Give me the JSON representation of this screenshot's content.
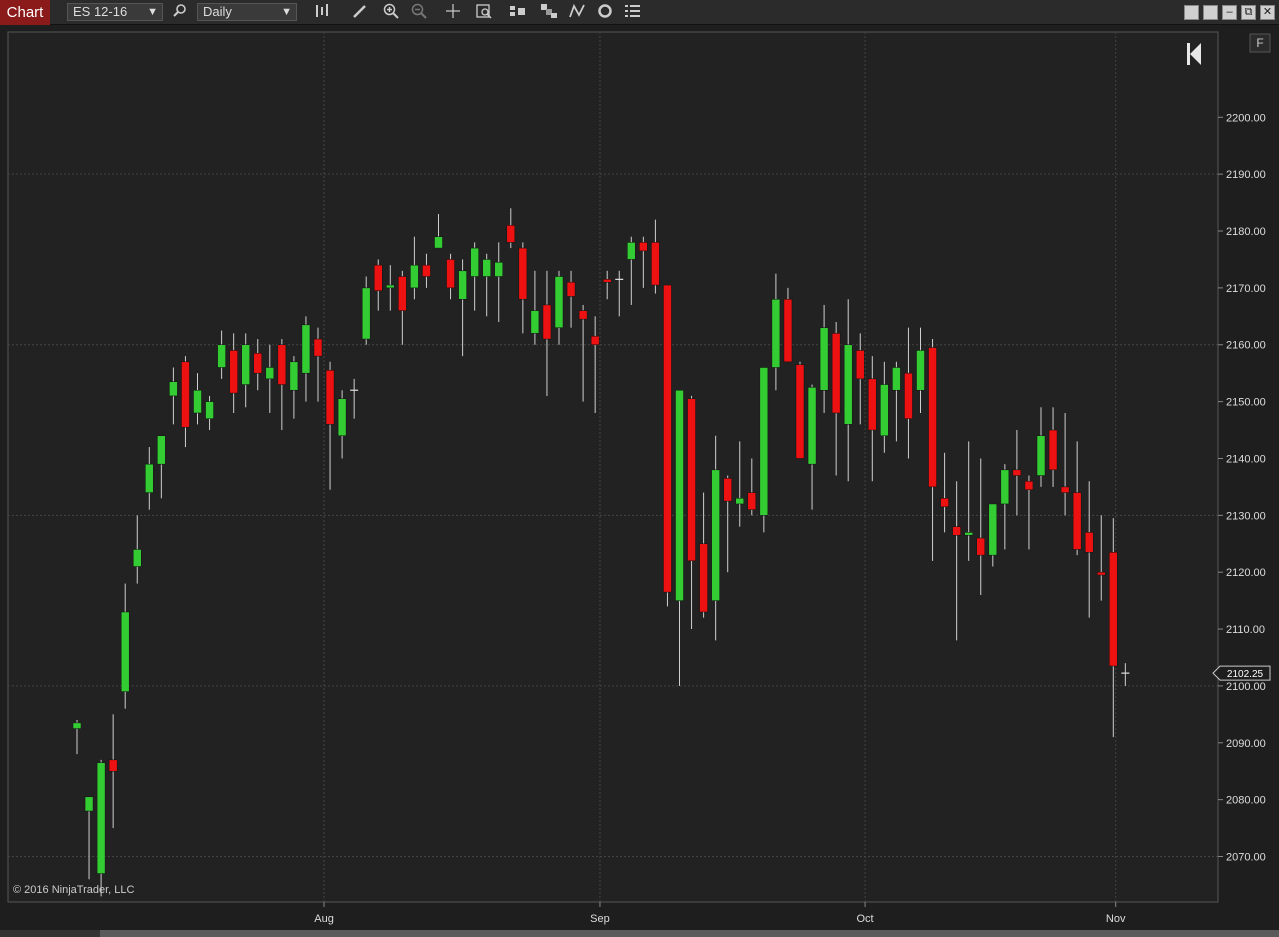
{
  "toolbar": {
    "tab_label": "Chart",
    "instrument": "ES 12-16",
    "interval": "Daily",
    "icons": [
      "search-icon",
      "bar-type-icon",
      "draw-pencil-icon",
      "zoom-in-icon",
      "zoom-out-icon",
      "crosshair-icon",
      "data-box-icon",
      "strategy-icon",
      "indicator-icon",
      "drawing-tools-icon",
      "reload-icon",
      "properties-icon"
    ],
    "window_buttons": [
      "tile-icon",
      "tile-icon",
      "minimize-icon",
      "restore-icon",
      "close-icon"
    ]
  },
  "chart": {
    "copyright": "© 2016 NinjaTrader, LLC",
    "last_price_label": "2102.25",
    "f_button": "F",
    "colors": {
      "background": "#222222",
      "up": "#33cc33",
      "down": "#ee1111",
      "grid": "#444444",
      "axis_text": "#dddddd"
    }
  },
  "chart_data": {
    "type": "candlestick",
    "yticks": [
      "2070.00",
      "2080.00",
      "2090.00",
      "2100.00",
      "2110.00",
      "2120.00",
      "2130.00",
      "2140.00",
      "2150.00",
      "2160.00",
      "2170.00",
      "2180.00",
      "2190.00",
      "2200.00"
    ],
    "ytick_values": [
      2070,
      2080,
      2090,
      2100,
      2110,
      2120,
      2130,
      2140,
      2150,
      2160,
      2170,
      2180,
      2190,
      2200
    ],
    "xticks": [
      {
        "label": "Aug",
        "index": 20.5
      },
      {
        "label": "Sep",
        "index": 43.4
      },
      {
        "label": "Oct",
        "index": 65.4
      },
      {
        "label": "Nov",
        "index": 86.2
      }
    ],
    "ylim": [
      2062,
      2215
    ],
    "grid": true,
    "last_price": 2102.25,
    "bars": [
      [
        2092.5,
        2094,
        2088,
        2093.5
      ],
      [
        2078,
        2079.5,
        2066,
        2080.5
      ],
      [
        2067,
        2087,
        2063,
        2086.5
      ],
      [
        2087,
        2095,
        2075,
        2085
      ],
      [
        2099,
        2118,
        2096,
        2113
      ],
      [
        2121,
        2130,
        2118,
        2124
      ],
      [
        2134,
        2142,
        2131,
        2139
      ],
      [
        2139,
        2144,
        2133,
        2144
      ],
      [
        2151,
        2156,
        2146,
        2153.5
      ],
      [
        2157,
        2158,
        2142,
        2145.5
      ],
      [
        2148,
        2155,
        2146,
        2152
      ],
      [
        2147,
        2151,
        2145,
        2150
      ],
      [
        2156,
        2162.5,
        2154,
        2160
      ],
      [
        2159,
        2162,
        2148,
        2151.5
      ],
      [
        2153,
        2162,
        2149,
        2160
      ],
      [
        2158.5,
        2161,
        2152,
        2155
      ],
      [
        2154,
        2160,
        2148,
        2156
      ],
      [
        2160,
        2161,
        2145,
        2153
      ],
      [
        2152,
        2158,
        2147,
        2157
      ],
      [
        2155,
        2165,
        2150,
        2163.5
      ],
      [
        2161,
        2163,
        2150,
        2158
      ],
      [
        2155.5,
        2157,
        2134.5,
        2146
      ],
      [
        2144,
        2152,
        2140,
        2150.5
      ],
      [
        2152,
        2154,
        2147,
        2152
      ],
      [
        2161,
        2172,
        2160,
        2170
      ],
      [
        2174,
        2175,
        2166,
        2169.5
      ],
      [
        2170,
        2174,
        2166,
        2170.5
      ],
      [
        2172,
        2173,
        2160,
        2166
      ],
      [
        2170,
        2179,
        2168,
        2174
      ],
      [
        2174,
        2176,
        2170,
        2172
      ],
      [
        2177,
        2183,
        2177,
        2179
      ],
      [
        2175,
        2176,
        2168,
        2170
      ],
      [
        2168,
        2175,
        2158,
        2173
      ],
      [
        2172,
        2178,
        2166,
        2177
      ],
      [
        2172,
        2176,
        2165,
        2175
      ],
      [
        2172,
        2178,
        2164,
        2174.5
      ],
      [
        2181,
        2184,
        2177,
        2178
      ],
      [
        2177,
        2178,
        2162,
        2168
      ],
      [
        2162,
        2173,
        2160,
        2166
      ],
      [
        2167,
        2173,
        2151,
        2161
      ],
      [
        2163,
        2173,
        2160,
        2172
      ],
      [
        2171,
        2173,
        2163,
        2168.5
      ],
      [
        2166,
        2167,
        2150,
        2164.5
      ],
      [
        2161.5,
        2165,
        2148,
        2160
      ],
      [
        2171.5,
        2173,
        2168,
        2171
      ],
      [
        2171.5,
        2173,
        2165,
        2171.5
      ],
      [
        2175,
        2179,
        2167,
        2178
      ],
      [
        2178,
        2179,
        2170,
        2176.5
      ],
      [
        2178,
        2182,
        2169,
        2170.5
      ],
      [
        2170.5,
        2170,
        2114,
        2116.5
      ],
      [
        2115,
        2146,
        2100,
        2152
      ],
      [
        2150.5,
        2151,
        2110,
        2122
      ],
      [
        2125,
        2134,
        2112,
        2113
      ],
      [
        2115,
        2144,
        2108,
        2138
      ],
      [
        2136.5,
        2137,
        2120,
        2132.5
      ],
      [
        2132,
        2143,
        2128,
        2133
      ],
      [
        2134,
        2140,
        2130,
        2131
      ],
      [
        2130,
        2146,
        2127,
        2156
      ],
      [
        2156,
        2172.5,
        2152,
        2168
      ],
      [
        2168,
        2170,
        2158,
        2157
      ],
      [
        2156.5,
        2157,
        2140,
        2140
      ],
      [
        2139,
        2153,
        2131,
        2152.5
      ],
      [
        2152,
        2167,
        2148,
        2163
      ],
      [
        2162,
        2164,
        2137,
        2148
      ],
      [
        2146,
        2168,
        2136,
        2160
      ],
      [
        2159,
        2162,
        2146,
        2154
      ],
      [
        2154,
        2158,
        2136,
        2145
      ],
      [
        2144,
        2157,
        2141,
        2153
      ],
      [
        2152,
        2157,
        2143,
        2156
      ],
      [
        2155,
        2163,
        2140,
        2147
      ],
      [
        2152,
        2163,
        2148,
        2159
      ],
      [
        2159.5,
        2161,
        2122,
        2135
      ],
      [
        2133,
        2141,
        2127,
        2131.5
      ],
      [
        2128,
        2136,
        2108,
        2126.5
      ],
      [
        2126.5,
        2143,
        2122,
        2127
      ],
      [
        2126,
        2140,
        2116,
        2123
      ],
      [
        2123,
        2132,
        2121,
        2132
      ],
      [
        2132,
        2139,
        2124,
        2138
      ],
      [
        2138,
        2145,
        2130,
        2137
      ],
      [
        2136,
        2137,
        2124,
        2134.5
      ],
      [
        2137,
        2149,
        2135,
        2144
      ],
      [
        2145,
        2149,
        2135,
        2138
      ],
      [
        2135,
        2148,
        2130,
        2134
      ],
      [
        2134,
        2143,
        2123,
        2124
      ],
      [
        2127,
        2136,
        2112,
        2123.5
      ],
      [
        2120,
        2130,
        2115,
        2119.5
      ],
      [
        2123.5,
        2129.5,
        2091,
        2103.5
      ],
      [
        2102.25,
        2104,
        2100,
        2102.25
      ]
    ]
  }
}
